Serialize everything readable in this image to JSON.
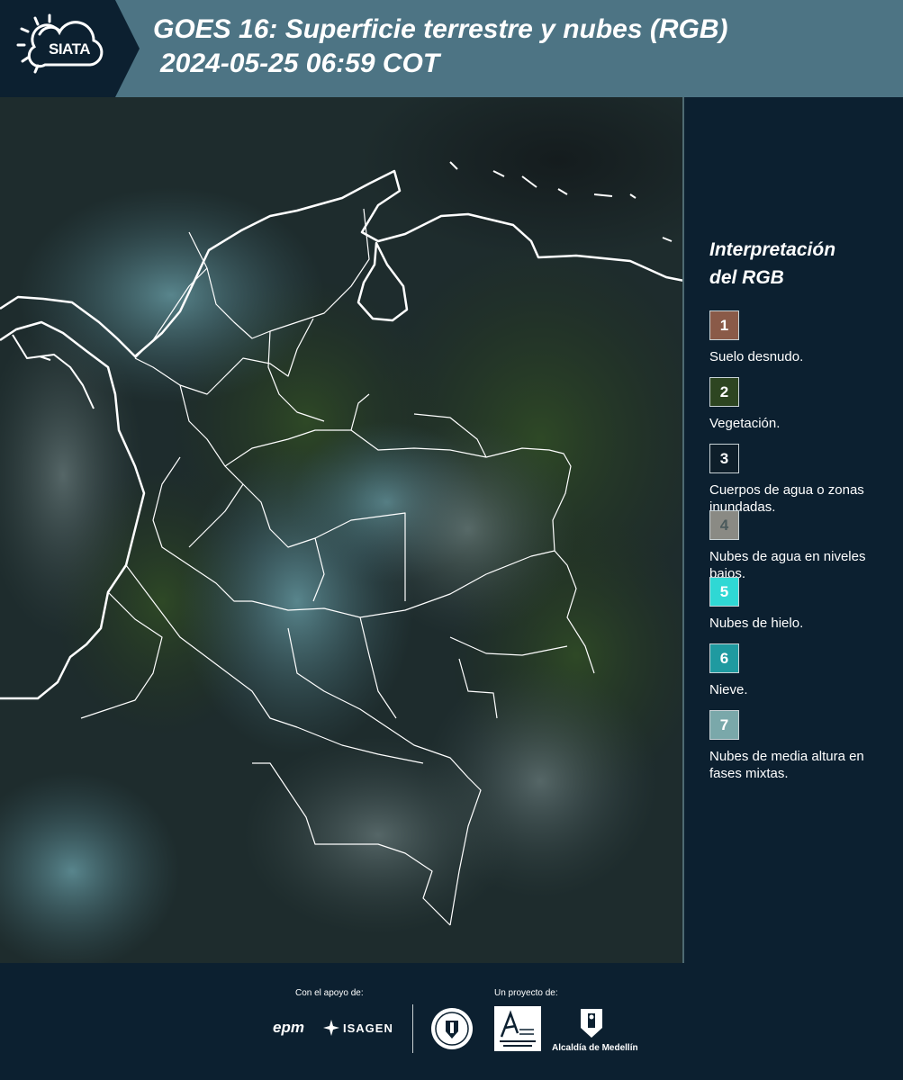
{
  "header": {
    "logo_text": "SIATA",
    "title_line1": "GOES 16: Superficie terrestre y nubes (RGB)",
    "title_line2": "2024-05-25 06:59 COT"
  },
  "map": {
    "icons": [
      "satellite-image",
      "country-borders"
    ]
  },
  "legend": {
    "title_line1": "Interpretación",
    "title_line2": "del RGB",
    "items": [
      {
        "number": "1",
        "label": "Suelo desnudo.",
        "color": "#8a5a48"
      },
      {
        "number": "2",
        "label": "Vegetación.",
        "color": "#2d4521"
      },
      {
        "number": "3",
        "label": "Cuerpos de agua o zonas inundadas.",
        "color": "#0e1e2a"
      },
      {
        "number": "4",
        "label": "Nubes de agua en niveles bajos.",
        "color": "#8a8a84"
      },
      {
        "number": "5",
        "label": "Nubes de hielo.",
        "color": "#2fd8d4"
      },
      {
        "number": "6",
        "label": "Nieve.",
        "color": "#1f9aa0"
      },
      {
        "number": "7",
        "label": "Nubes de media altura en fases mixtas.",
        "color": "#7aa8aa"
      }
    ]
  },
  "footer": {
    "support_label": "Con el apoyo de:",
    "project_label": "Un proyecto de:",
    "sponsors": {
      "epm": "epm",
      "isagen": "ISAGEN",
      "alcaldia": "Alcaldía de Medellín"
    },
    "icons": [
      "medellin-university-seal-icon",
      "area-metropolitana-logo-icon",
      "alcaldia-shield-icon"
    ]
  },
  "colors": {
    "header_bg": "#4d7484",
    "logo_bg": "#0c2030",
    "footer_bg": "#0c2030",
    "border_line": "#ffffff"
  }
}
